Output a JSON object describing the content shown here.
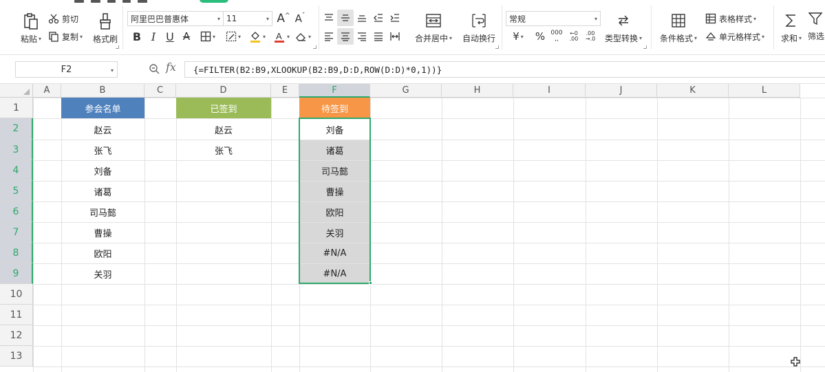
{
  "ribbon": {
    "paste": "粘贴",
    "cut": "剪切",
    "copy": "复制",
    "format_painter": "格式刷",
    "font_name": "阿里巴巴普惠体",
    "font_size": "11",
    "merge_center": "合并居中",
    "wrap_text": "自动换行",
    "number_format": "常规",
    "convert_type": "类型转换",
    "conditional_format": "条件格式",
    "table_style": "表格样式",
    "cell_style": "单元格样式",
    "sum": "求和",
    "filter": "筛选",
    "font_color": "#e03c31",
    "fill_color": "#f5c41c"
  },
  "formula_bar": {
    "name_box": "F2",
    "fx": "fx",
    "formula": "{=FILTER(B2:B9,XLOOKUP(B2:B9,D:D,ROW(D:D)*0,1))}"
  },
  "grid": {
    "columns": [
      "A",
      "B",
      "C",
      "D",
      "E",
      "F",
      "G",
      "H",
      "I",
      "J",
      "K",
      "L"
    ],
    "rows": [
      "1",
      "2",
      "3",
      "4",
      "5",
      "6",
      "7",
      "8",
      "9",
      "10",
      "11",
      "12",
      "13"
    ],
    "selected_column": "F",
    "header_colors": {
      "b": "#4f81bd",
      "d": "#9bbb59",
      "f": "#f79646"
    },
    "headers": {
      "b": "参会名单",
      "d": "已签到",
      "f": "待签到"
    },
    "col_b": [
      "赵云",
      "张飞",
      "刘备",
      "诸葛",
      "司马懿",
      "曹操",
      "欧阳",
      "关羽"
    ],
    "col_d": [
      "赵云",
      "张飞"
    ],
    "col_f": [
      "刘备",
      "诸葛",
      "司马懿",
      "曹操",
      "欧阳",
      "关羽",
      "#N/A",
      "#N/A"
    ]
  }
}
